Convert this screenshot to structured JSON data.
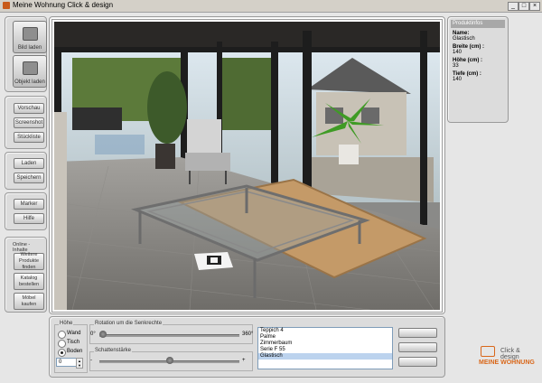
{
  "window": {
    "title": "Meine Wohnung Click & design",
    "buttons": [
      "_",
      "□",
      "×"
    ]
  },
  "sidebar": {
    "top_buttons": [
      {
        "label": "Bild laden",
        "icon": "image-icon"
      },
      {
        "label": "Objekt laden",
        "icon": "box-icon"
      }
    ],
    "group2": [
      "Vorschau",
      "Screenshot",
      "Stückliste"
    ],
    "group3": [
      "Laden",
      "Speichern"
    ],
    "group4": [
      "Marker",
      "Hilfe"
    ],
    "online": {
      "title": "Online - Inhalte",
      "buttons": [
        "Weitere Produkte finden",
        "Katalog bestellen",
        "Möbel kaufen"
      ]
    }
  },
  "info": {
    "title": "Produktinfos",
    "name_label": "Name:",
    "name_value": "Glastisch",
    "width_label": "Breite (cm) :",
    "width_value": "140",
    "height_label": "Höhe (cm) :",
    "height_value": "33",
    "depth_label": "Tiefe (cm) :",
    "depth_value": "140"
  },
  "controls": {
    "height": {
      "title": "Höhe",
      "options": [
        "Wand",
        "Tisch",
        "Boden"
      ],
      "selected": "Boden",
      "value": "0"
    },
    "rotation": {
      "title": "Rotation um die Senkrechte",
      "min": "0°",
      "max": "360°",
      "level": 0
    },
    "shadow": {
      "title": "Schattenstärke",
      "min": "-",
      "max": "+",
      "level": 0.5
    }
  },
  "objects": {
    "items": [
      "Teppich 4",
      "Palme",
      "Zimmerbaum",
      "Serie F 55",
      "Glastisch"
    ],
    "selected": "Glastisch"
  },
  "logo": {
    "line1": "Click & design",
    "line2": "MEINE WOHNUNG"
  },
  "colors": {
    "accent": "#d9671a",
    "selection": "#bcd3ee"
  }
}
